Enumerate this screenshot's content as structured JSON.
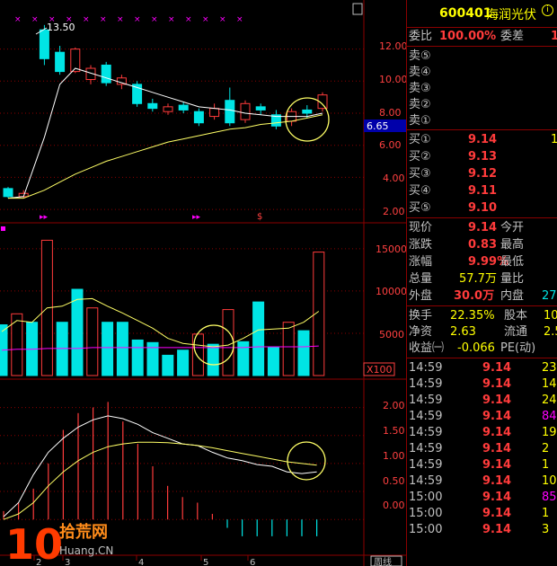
{
  "stock": {
    "code": "600401",
    "name": "海润光伏",
    "info_icon": "circle-info-icon"
  },
  "price_axis": {
    "ticks": [
      "12.00",
      "10.00",
      "8.00",
      "6.00",
      "4.00",
      "2.00"
    ],
    "current": "6.65"
  },
  "volume_axis": {
    "ticks": [
      "15000",
      "10000",
      "5000"
    ],
    "multiplier": "X100"
  },
  "macd_axis": {
    "ticks": [
      "2.00",
      "1.50",
      "1.00",
      "0.50",
      "0.00"
    ]
  },
  "annotations": {
    "high_label": "13.50"
  },
  "date_ticks": [
    "2",
    "3",
    "4",
    "5",
    "6"
  ],
  "bottom_tab": "周线",
  "colors": {
    "up": "#ff3b3b",
    "down": "#00e5e5",
    "ma_white": "#ffffff",
    "ma_yellow": "#ffff66",
    "grid": "#8b0000",
    "circle": "#ffff66",
    "vol_ma_magenta": "#ff00ff"
  },
  "ratio": {
    "l1": "委比",
    "v1": "100.00%",
    "l2": "委差",
    "v2": "1"
  },
  "sell": [
    {
      "label": "卖⑤"
    },
    {
      "label": "卖④"
    },
    {
      "label": "卖③"
    },
    {
      "label": "卖②"
    },
    {
      "label": "卖①"
    }
  ],
  "buy": [
    {
      "label": "买①",
      "price": "9.14",
      "vol": "1"
    },
    {
      "label": "买②",
      "price": "9.13",
      "vol": ""
    },
    {
      "label": "买③",
      "price": "9.12",
      "vol": ""
    },
    {
      "label": "买④",
      "price": "9.11",
      "vol": ""
    },
    {
      "label": "买⑤",
      "price": "9.10",
      "vol": ""
    }
  ],
  "stats": [
    {
      "l1": "现价",
      "v1": "9.14",
      "l2": "今开",
      "v2": ""
    },
    {
      "l1": "涨跌",
      "v1": "0.83",
      "l2": "最高",
      "v2": ""
    },
    {
      "l1": "涨幅",
      "v1": "9.99%",
      "l2": "最低",
      "v2": ""
    },
    {
      "l1": "总量",
      "v1": "57.7万",
      "l2": "量比",
      "v2": ""
    },
    {
      "l1": "外盘",
      "v1": "30.0万",
      "l2": "内盘",
      "v2": "27."
    }
  ],
  "fund": [
    {
      "l1": "换手",
      "v1": "22.35%",
      "l2": "股本",
      "v2": "10"
    },
    {
      "l1": "净资",
      "v1": "2.63",
      "l2": "流通",
      "v2": "2.5"
    },
    {
      "l1": "收益㈠",
      "v1": "-0.066",
      "l2": "PE(动)",
      "v2": ""
    }
  ],
  "ticks": [
    {
      "t": "14:59",
      "p": "9.14",
      "v": "23"
    },
    {
      "t": "14:59",
      "p": "9.14",
      "v": "14"
    },
    {
      "t": "14:59",
      "p": "9.14",
      "v": "24"
    },
    {
      "t": "14:59",
      "p": "9.14",
      "v": "84"
    },
    {
      "t": "14:59",
      "p": "9.14",
      "v": "19"
    },
    {
      "t": "14:59",
      "p": "9.14",
      "v": "2"
    },
    {
      "t": "14:59",
      "p": "9.14",
      "v": "1"
    },
    {
      "t": "14:59",
      "p": "9.14",
      "v": "10"
    },
    {
      "t": "15:00",
      "p": "9.14",
      "v": "85"
    },
    {
      "t": "15:00",
      "p": "9.14",
      "v": "1"
    },
    {
      "t": "15:00",
      "p": "9.14",
      "v": "3"
    }
  ],
  "watermark": {
    "num": "10",
    "text": "拾荒网",
    "url": "Huang.CN"
  },
  "chart_data": {
    "type": "candlestick",
    "price_range": [
      1.5,
      14.5
    ],
    "candles": [
      {
        "o": 2.8,
        "c": 3.3,
        "h": 3.4,
        "l": 2.7,
        "up": false
      },
      {
        "o": 2.8,
        "c": 3.0,
        "h": 3.2,
        "l": 2.7,
        "up": true
      },
      {
        "o": 11.4,
        "c": 13.2,
        "h": 13.5,
        "l": 11.0,
        "up": false
      },
      {
        "o": 11.8,
        "c": 10.6,
        "h": 12.2,
        "l": 10.4,
        "up": false
      },
      {
        "o": 10.6,
        "c": 12.0,
        "h": 12.1,
        "l": 10.5,
        "up": true
      },
      {
        "o": 10.8,
        "c": 10.1,
        "h": 11.0,
        "l": 9.8,
        "up": true
      },
      {
        "o": 11.0,
        "c": 9.9,
        "h": 11.2,
        "l": 9.7,
        "up": false
      },
      {
        "o": 10.2,
        "c": 9.8,
        "h": 10.4,
        "l": 9.5,
        "up": true
      },
      {
        "o": 9.8,
        "c": 8.6,
        "h": 10.0,
        "l": 8.4,
        "up": false
      },
      {
        "o": 8.6,
        "c": 8.3,
        "h": 8.9,
        "l": 8.1,
        "up": false
      },
      {
        "o": 8.4,
        "c": 8.1,
        "h": 8.6,
        "l": 7.9,
        "up": true
      },
      {
        "o": 8.2,
        "c": 8.5,
        "h": 8.7,
        "l": 8.0,
        "up": false
      },
      {
        "o": 8.1,
        "c": 7.4,
        "h": 8.3,
        "l": 7.2,
        "up": false
      },
      {
        "o": 7.8,
        "c": 8.3,
        "h": 8.6,
        "l": 7.6,
        "up": true
      },
      {
        "o": 8.8,
        "c": 7.4,
        "h": 9.6,
        "l": 7.2,
        "up": false
      },
      {
        "o": 7.6,
        "c": 8.6,
        "h": 8.8,
        "l": 7.4,
        "up": true
      },
      {
        "o": 8.2,
        "c": 8.4,
        "h": 8.6,
        "l": 7.9,
        "up": false
      },
      {
        "o": 7.9,
        "c": 7.2,
        "h": 8.2,
        "l": 7.0,
        "up": false
      },
      {
        "o": 7.5,
        "c": 8.1,
        "h": 8.3,
        "l": 7.2,
        "up": true
      },
      {
        "o": 8.0,
        "c": 8.2,
        "h": 8.5,
        "l": 7.7,
        "up": false
      },
      {
        "o": 8.3,
        "c": 9.14,
        "h": 9.3,
        "l": 8.1,
        "up": true
      }
    ],
    "ma_white": [
      2.7,
      2.8,
      6.5,
      9.8,
      10.8,
      10.5,
      10.2,
      9.9,
      9.6,
      9.3,
      9.0,
      8.7,
      8.4,
      8.3,
      8.2,
      8.0,
      7.9,
      7.8,
      7.8,
      7.8,
      8.0
    ],
    "ma_yellow": [
      2.7,
      2.7,
      3.2,
      3.7,
      4.2,
      4.6,
      5.0,
      5.3,
      5.6,
      5.9,
      6.2,
      6.4,
      6.6,
      6.8,
      7.0,
      7.1,
      7.3,
      7.4,
      7.5,
      7.7,
      7.9
    ],
    "volume_range": [
      0,
      17000
    ],
    "volumes": [
      6000,
      7300,
      6300,
      16000,
      6300,
      10200,
      8000,
      6300,
      6300,
      4200,
      3900,
      2400,
      3000,
      4900,
      3700,
      7800,
      4000,
      8700,
      3400,
      6300,
      5300,
      14600
    ],
    "volume_up": [
      false,
      true,
      false,
      true,
      false,
      false,
      true,
      false,
      false,
      false,
      false,
      false,
      false,
      true,
      false,
      true,
      false,
      false,
      false,
      true,
      false,
      true
    ],
    "vol_ma": [
      5200,
      6500,
      6300,
      8000,
      8200,
      9000,
      9100,
      8200,
      7400,
      6500,
      5600,
      4400,
      3800,
      3600,
      3400,
      3600,
      4400,
      5400,
      5500,
      5600,
      6300,
      7600
    ],
    "vol_ma2": [
      3000,
      3100,
      3100,
      3200,
      3200,
      3200,
      3300,
      3300,
      3300,
      3300,
      3300,
      3300,
      3300,
      3300,
      3300,
      3300,
      3300,
      3400,
      3400,
      3400,
      3400,
      3500
    ],
    "macd_range": [
      -0.35,
      2.25
    ],
    "macd_hist": [
      0.15,
      0.3,
      0.55,
      1.0,
      1.6,
      1.9,
      2.0,
      2.1,
      1.75,
      1.35,
      0.95,
      0.6,
      0.4,
      0.3,
      0.1,
      -0.15,
      -0.3,
      -0.3,
      -0.3,
      -0.3,
      -0.3,
      -0.3
    ],
    "dif": [
      0.05,
      0.3,
      0.8,
      1.2,
      1.45,
      1.65,
      1.78,
      1.85,
      1.8,
      1.7,
      1.55,
      1.45,
      1.35,
      1.32,
      1.2,
      1.1,
      1.05,
      0.98,
      0.95,
      0.85,
      0.82,
      0.85
    ],
    "dea": [
      0.0,
      0.1,
      0.3,
      0.6,
      0.85,
      1.05,
      1.2,
      1.3,
      1.35,
      1.38,
      1.38,
      1.37,
      1.35,
      1.32,
      1.28,
      1.23,
      1.18,
      1.13,
      1.08,
      1.03,
      1.0,
      0.97
    ]
  }
}
